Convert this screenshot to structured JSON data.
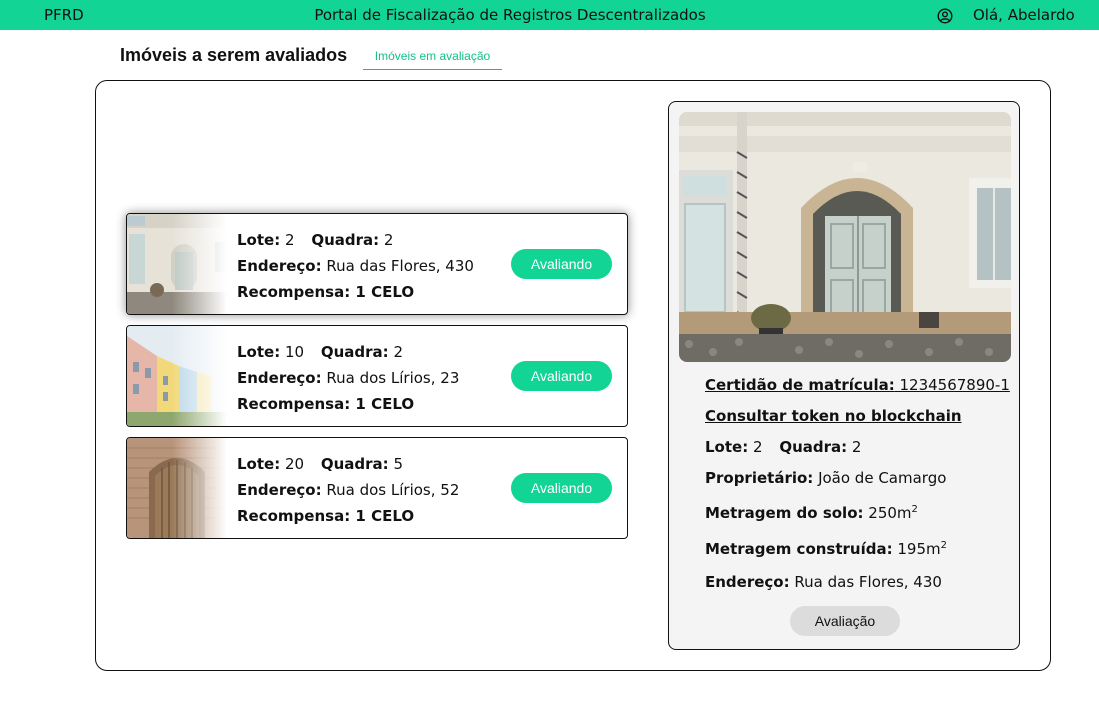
{
  "header": {
    "brand": "PFRD",
    "title": "Portal de Fiscalização de Registros Descentralizados",
    "greeting": "Olá, Abelardo",
    "user_icon": "user-circle-icon",
    "bg_color": "#12d494"
  },
  "page": {
    "title": "Imóveis a serem avaliados",
    "tab_label": "Imóveis em avaliação"
  },
  "properties": [
    {
      "lote_label": "Lote:",
      "lote": "2",
      "quadra_label": "Quadra:",
      "quadra": "2",
      "endereco_label": "Endereço:",
      "endereco": "Rua das Flores, 430",
      "recompensa": "Recompensa: 1 CELO",
      "status": "Avaliando",
      "selected": true
    },
    {
      "lote_label": "Lote:",
      "lote": "10",
      "quadra_label": "Quadra:",
      "quadra": "2",
      "endereco_label": "Endereço:",
      "endereco": "Rua dos Lírios, 23",
      "recompensa": "Recompensa: 1 CELO",
      "status": "Avaliando",
      "selected": false
    },
    {
      "lote_label": "Lote:",
      "lote": "20",
      "quadra_label": "Quadra:",
      "quadra": "5",
      "endereco_label": "Endereço:",
      "endereco": "Rua dos Lírios, 52",
      "recompensa": "Recompensa: 1 CELO",
      "status": "Avaliando",
      "selected": false
    }
  ],
  "detail": {
    "certidao_label": "Certidão de matrícula:",
    "certidao": "1234567890-1",
    "token_link": "Consultar token no blockchain",
    "lote_label": "Lote:",
    "lote": "2",
    "quadra_label": "Quadra:",
    "quadra": "2",
    "proprietario_label": "Proprietário:",
    "proprietario": "João de Camargo",
    "solo_label": "Metragem do solo:",
    "solo": "250m",
    "solo_exp": "2",
    "construida_label": "Metragem construída:",
    "construida": "195m",
    "construida_exp": "2",
    "endereco_label": "Endereço:",
    "endereco": "Rua das Flores, 430",
    "eval_button": "Avaliação"
  },
  "colors": {
    "accent": "#12d494",
    "panel": "#f4f4f4",
    "button_gray": "#dcdcdc"
  }
}
